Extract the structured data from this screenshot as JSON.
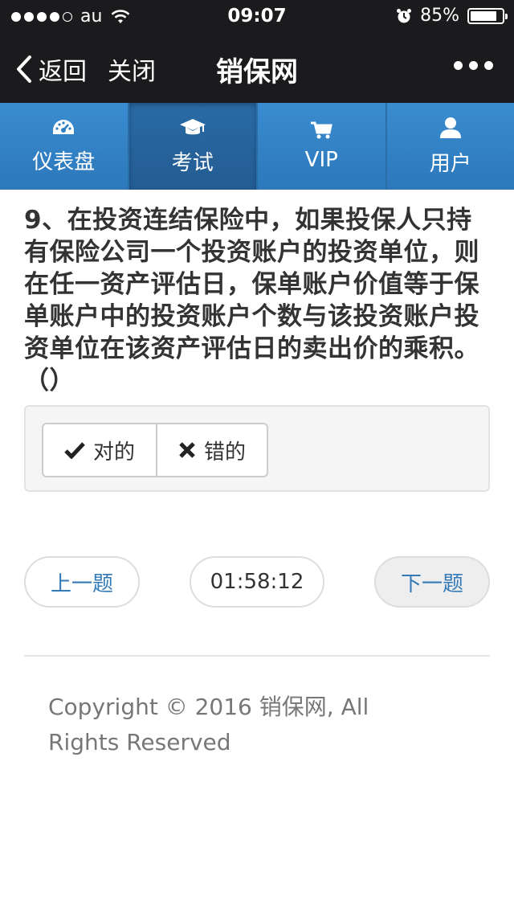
{
  "status_bar": {
    "carrier": "au",
    "time": "09:07",
    "battery": "85%",
    "battery_level": 0.85
  },
  "nav": {
    "back_label": "返回",
    "close_label": "关闭",
    "title": "销保网"
  },
  "tabs": [
    {
      "label": "仪表盘",
      "icon": "dashboard-icon",
      "active": false
    },
    {
      "label": "考试",
      "icon": "graduation-cap-icon",
      "active": true
    },
    {
      "label": "VIP",
      "icon": "cart-icon",
      "active": false
    },
    {
      "label": "用户",
      "icon": "user-icon",
      "active": false
    }
  ],
  "question": {
    "text": "9、在投资连结保险中，如果投保人只持有保险公司一个投资账户的投资单位，则在任一资产评估日，保单账户价值等于保单账户中的投资账户个数与该投资账户投资单位在该资产评估日的卖出价的乘积。（）"
  },
  "answers": {
    "true_label": "对的",
    "false_label": "错的"
  },
  "pager": {
    "prev_label": "上一题",
    "timer": "01:58:12",
    "next_label": "下一题"
  },
  "footer": {
    "copyright": "Copyright © 2016 销保网, All Rights Reserved"
  },
  "colors": {
    "tab_bg": "#2f7fc1",
    "tab_active_bg": "#235c92",
    "link": "#337ab7",
    "navbar_bg": "#1b1b1d"
  }
}
